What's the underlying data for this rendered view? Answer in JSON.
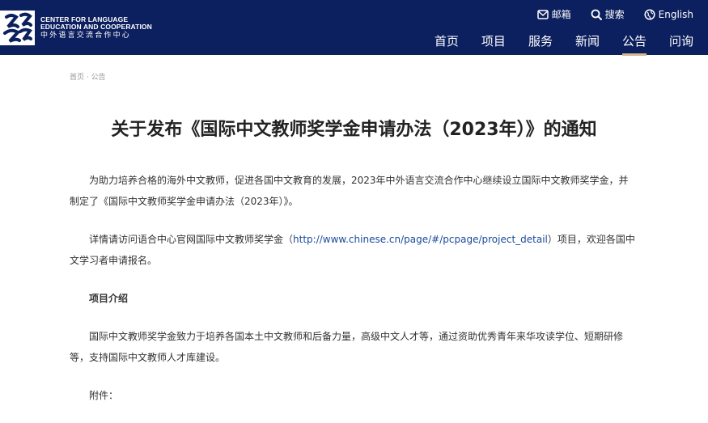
{
  "header": {
    "logo_glyph": "中文",
    "logo_en_line1": "CENTER FOR LANGUAGE",
    "logo_en_line2": "EDUCATION AND COOPERATION",
    "logo_zh": "中外语言交流合作中心",
    "utility": {
      "mail_label": "邮箱",
      "search_label": "搜索",
      "english_label": "English"
    },
    "nav": [
      {
        "label": "首页"
      },
      {
        "label": "项目"
      },
      {
        "label": "服务"
      },
      {
        "label": "新闻"
      },
      {
        "label": "公告",
        "active": true
      },
      {
        "label": "问询"
      }
    ]
  },
  "breadcrumb": {
    "home": "首页",
    "separator": "·",
    "current": "公告"
  },
  "article": {
    "title": "关于发布《国际中文教师奖学金申请办法（2023年）》的通知",
    "para1": "为助力培养合格的海外中文教师，促进各国中文教育的发展，2023年中外语言交流合作中心继续设立国际中文教师奖学金，并制定了《国际中文教师奖学金申请办法（2023年）》。",
    "para2_before": "详情请访问语合中心官网国际中文教师奖学金（",
    "para2_link": "http://www.chinese.cn/page/#/pcpage/project_detail",
    "para2_after": "）项目，欢迎各国中文学习者申请报名。",
    "section_heading": "项目介绍",
    "para3": "国际中文教师奖学金致力于培养各国本土中文教师和后备力量，高级中文人才等，通过资助优秀青年来华攻读学位、短期研修等，支持国际中文教师人才库建设。",
    "attachment_label": "附件："
  },
  "colors": {
    "header_bg": "#0c1f5e",
    "nav_active_underline": "#d6b98c",
    "link": "#1a4b9b"
  }
}
